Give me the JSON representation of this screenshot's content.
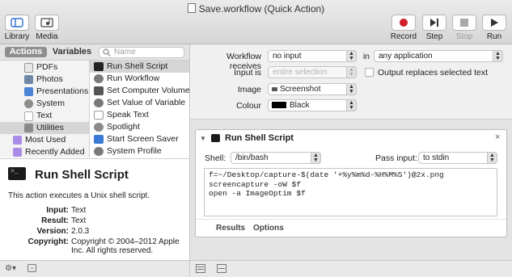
{
  "window": {
    "title": "Save.workflow (Quick Action)"
  },
  "toolbar": {
    "library_label": "Library",
    "media_label": "Media",
    "record_label": "Record",
    "step_label": "Step",
    "stop_label": "Stop",
    "run_label": "Run"
  },
  "library": {
    "tabs": [
      "Actions",
      "Variables"
    ],
    "search_placeholder": "Name",
    "categories": [
      {
        "label": "PDFs",
        "icon": "pdf-icon"
      },
      {
        "label": "Photos",
        "icon": "photos-icon"
      },
      {
        "label": "Presentations",
        "icon": "presentations-icon"
      },
      {
        "label": "System",
        "icon": "system-icon"
      },
      {
        "label": "Text",
        "icon": "text-icon"
      },
      {
        "label": "Utilities",
        "icon": "utilities-icon"
      },
      {
        "label": "Most Used",
        "icon": "folder-icon"
      },
      {
        "label": "Recently Added",
        "icon": "folder-icon"
      }
    ],
    "actions": [
      {
        "label": "Run Shell Script",
        "icon": "terminal-icon"
      },
      {
        "label": "Run Workflow",
        "icon": "automator-icon"
      },
      {
        "label": "Set Computer Volume",
        "icon": "speaker-icon"
      },
      {
        "label": "Set Value of Variable",
        "icon": "automator-icon"
      },
      {
        "label": "Speak Text",
        "icon": "speak-icon"
      },
      {
        "label": "Spotlight",
        "icon": "spotlight-icon"
      },
      {
        "label": "Start Screen Saver",
        "icon": "screensaver-icon"
      },
      {
        "label": "System Profile",
        "icon": "automator-icon"
      }
    ]
  },
  "description": {
    "title": "Run Shell Script",
    "summary": "This action executes a Unix shell script.",
    "input_key": "Input:",
    "input_value": "Text",
    "result_key": "Result:",
    "result_value": "Text",
    "version_key": "Version:",
    "version_value": "2.0.3",
    "copyright_key": "Copyright:",
    "copyright_line1": "Copyright © 2004–2012 Apple",
    "copyright_line2": "Inc. All rights reserved."
  },
  "workflow": {
    "receives_label": "Workflow receives",
    "receives_value": "no input",
    "in_label": "in",
    "in_value": "any application",
    "input_is_label": "Input is",
    "input_is_value": "entire selection",
    "replace_label": "Output replaces selected text",
    "image_label": "Image",
    "image_value": "Screenshot",
    "colour_label": "Colour",
    "colour_value": "Black"
  },
  "action_card": {
    "title": "Run Shell Script",
    "shell_label": "Shell:",
    "shell_value": "/bin/bash",
    "pass_label": "Pass input:",
    "pass_value": "to stdin",
    "script_lines": [
      "f=~/Desktop/capture-$(date '+%y%m%d-%H%M%S')@2x.png",
      "screencapture -oW $f",
      "open -a ImageOptim $f"
    ],
    "results_tab": "Results",
    "options_tab": "Options"
  },
  "colors": {
    "record": "#d0202a",
    "selection": "#d5d5d5",
    "black_swatch": "#000000"
  }
}
